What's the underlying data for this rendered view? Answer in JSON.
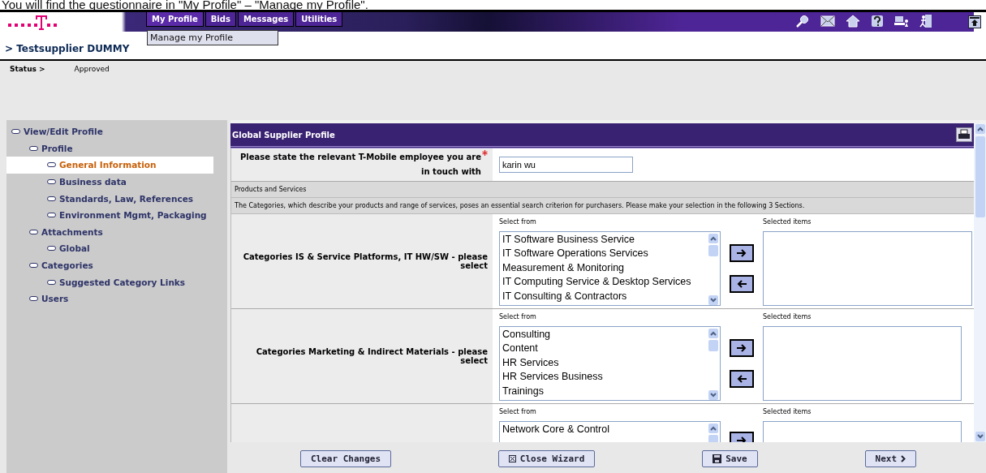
{
  "caption": "You will find the questionnaire in \"My Profile\" – \"Manage my Profile\".",
  "nav": {
    "tabs": [
      {
        "label": "My Profile",
        "selected": true
      },
      {
        "label": "Bids",
        "selected": false
      },
      {
        "label": "Messages",
        "selected": false
      },
      {
        "label": "Utilities",
        "selected": false
      }
    ],
    "menu": [
      "Manage my Profile"
    ]
  },
  "supplier_title": "> Testsupplier DUMMY",
  "status": {
    "label": "Status >",
    "value": "Approved"
  },
  "sidebar": {
    "items": [
      {
        "label": "View/Edit Profile",
        "selected": false,
        "children": [
          {
            "label": "Profile",
            "selected": false,
            "children": [
              {
                "label": "General Information",
                "selected": true
              },
              {
                "label": "Business data",
                "selected": false
              },
              {
                "label": "Standards, Law, References",
                "selected": false
              },
              {
                "label": "Environment Mgmt, Packaging",
                "selected": false
              }
            ]
          },
          {
            "label": "Attachments",
            "selected": false,
            "children": [
              {
                "label": "Global",
                "selected": false
              }
            ]
          },
          {
            "label": "Categories",
            "selected": false,
            "children": [
              {
                "label": "Suggested Category Links",
                "selected": false
              }
            ]
          },
          {
            "label": "Users",
            "selected": false
          }
        ]
      }
    ]
  },
  "panel": {
    "title": "Global Supplier Profile",
    "employee": {
      "label": "Please state the relevant T-Mobile employee you are in touch with",
      "required": true,
      "value": "karin wu"
    },
    "section_title": "Products and Services",
    "section_note": "The Categories, which describe your products and range of services, poses an essential search criterion for purchasers. Please make your selection in the following 3 Sections.",
    "categories": [
      {
        "label": "Categories IS & Service Platforms, IT HW/SW - please select",
        "from_label": "Select from",
        "selected_label": "Selected items",
        "options": [
          "IT Software Business Service",
          "IT Software Operations Services",
          "Measurement & Monitoring",
          "IT Computing Service & Desktop Services",
          "IT Consulting & Contractors"
        ]
      },
      {
        "label": "Categories Marketing & Indirect Materials - please select",
        "from_label": "Select from",
        "selected_label": "Selected items",
        "options": [
          "Consulting",
          "Content",
          "HR Services",
          "HR Services Business",
          "Trainings"
        ]
      },
      {
        "from_label": "Select from",
        "selected_label": "Selected items",
        "options": [
          "Network Core & Control"
        ],
        "arrows_cut": true
      }
    ]
  },
  "buttons": [
    {
      "label": "Clear Changes",
      "kind": "plain"
    },
    {
      "label": "Close Wizard",
      "kind": "close"
    },
    {
      "label": "Save",
      "kind": "save"
    },
    {
      "label": "Next",
      "kind": "next"
    }
  ]
}
